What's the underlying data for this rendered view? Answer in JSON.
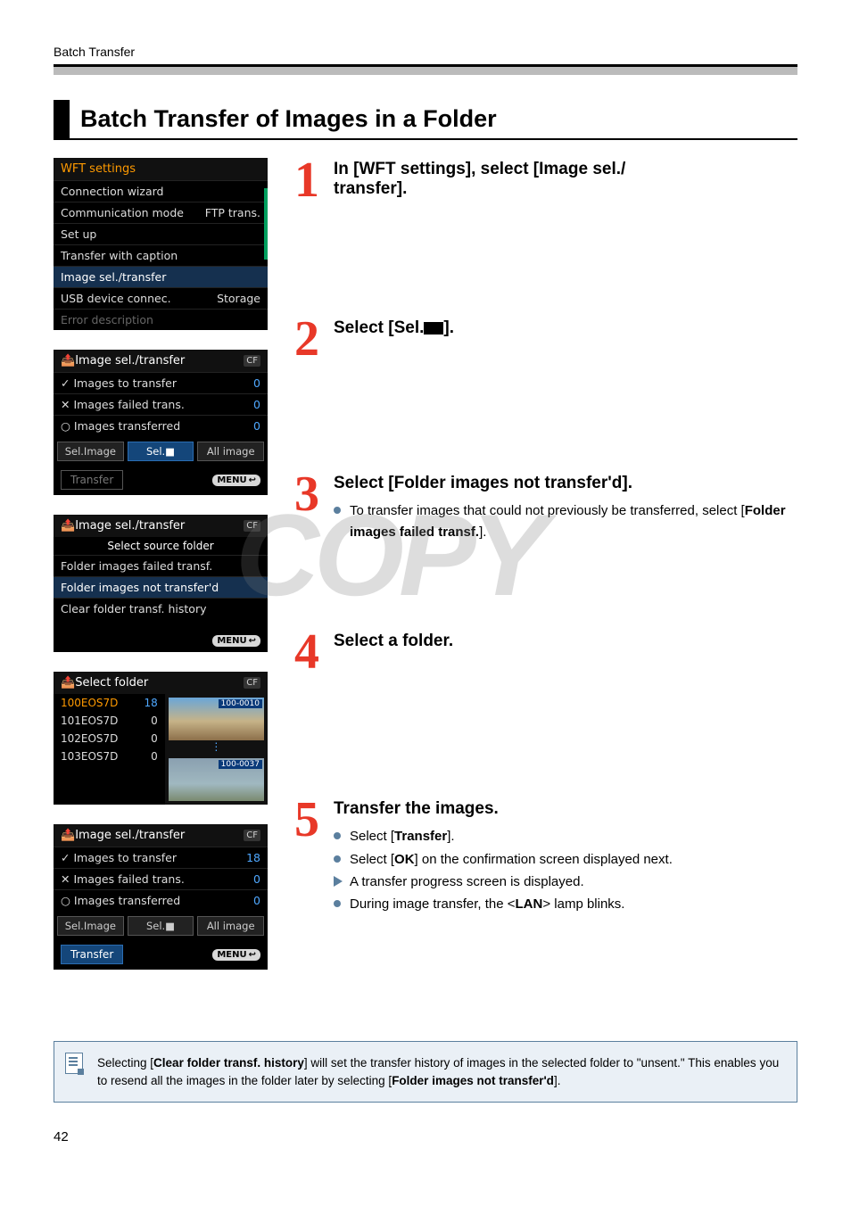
{
  "running_head": "Batch Transfer",
  "section_title": "Batch Transfer of Images in a Folder",
  "watermark": "COPY",
  "page_number": "42",
  "panel1": {
    "title": "WFT settings",
    "rows": [
      {
        "label": "Connection wizard",
        "value": ""
      },
      {
        "label": "Communication mode",
        "value": "FTP trans."
      },
      {
        "label": "Set up",
        "value": ""
      },
      {
        "label": "Transfer with caption",
        "value": ""
      },
      {
        "label": "Image sel./transfer",
        "value": "",
        "highlight": true
      },
      {
        "label": "USB device connec.",
        "value": "Storage"
      },
      {
        "label": "Error description",
        "value": "",
        "dim": true
      }
    ]
  },
  "panel2": {
    "title": "Image sel./transfer",
    "badge": "CF",
    "counts": [
      {
        "icon": "✓",
        "label": "Images to transfer",
        "value": "0"
      },
      {
        "icon": "✕",
        "label": "Images failed trans.",
        "value": "0"
      },
      {
        "icon": "○",
        "label": "Images transferred",
        "value": "0"
      }
    ],
    "buttons": [
      "Sel.Image",
      "Sel.■",
      "All image"
    ],
    "active_button": 1,
    "transfer_label": "Transfer",
    "transfer_active": false,
    "menu_label": "MENU"
  },
  "panel3": {
    "title": "Image sel./transfer",
    "badge": "CF",
    "subtitle": "Select source folder",
    "rows": [
      "Folder images failed transf.",
      "Folder images not transfer'd",
      "Clear folder transf. history"
    ],
    "highlight_index": 1,
    "menu_label": "MENU"
  },
  "panel4": {
    "title": "Select folder",
    "badge": "CF",
    "folders": [
      {
        "name": "100EOS7D",
        "count": "18",
        "selected": true
      },
      {
        "name": "101EOS7D",
        "count": "0"
      },
      {
        "name": "102EOS7D",
        "count": "0"
      },
      {
        "name": "103EOS7D",
        "count": "0"
      }
    ],
    "thumb1_label": "100-0010",
    "thumb2_label": "100-0037"
  },
  "panel5": {
    "title": "Image sel./transfer",
    "badge": "CF",
    "counts": [
      {
        "icon": "✓",
        "label": "Images to transfer",
        "value": "18"
      },
      {
        "icon": "✕",
        "label": "Images failed trans.",
        "value": "0"
      },
      {
        "icon": "○",
        "label": "Images transferred",
        "value": "0"
      }
    ],
    "buttons": [
      "Sel.Image",
      "Sel.■",
      "All image"
    ],
    "active_button": -1,
    "transfer_label": "Transfer",
    "transfer_active": true,
    "menu_label": "MENU"
  },
  "steps": {
    "s1": {
      "num": "1",
      "head_a": "In [WFT settings], select [Image sel./",
      "head_b": "transfer]."
    },
    "s2": {
      "num": "2",
      "head": "Select [Sel.",
      "head_tail": "]."
    },
    "s3": {
      "num": "3",
      "head": "Select [Folder images not transfer'd].",
      "b1a": "To transfer images that could not previously be transferred, select [",
      "b1b": "Folder images failed transf.",
      "b1c": "]."
    },
    "s4": {
      "num": "4",
      "head": "Select a folder."
    },
    "s5": {
      "num": "5",
      "head": "Transfer the images.",
      "b1a": "Select [",
      "b1b": "Transfer",
      "b1c": "].",
      "b2a": "Select [",
      "b2b": "OK",
      "b2c": "] on the confirmation screen displayed next.",
      "b3": "A transfer progress screen is displayed.",
      "b4a": "During image transfer, the <",
      "b4b": "LAN",
      "b4c": "> lamp blinks."
    }
  },
  "note": {
    "a": "Selecting [",
    "b": "Clear folder transf. history",
    "c": "] will set the transfer history of images in the selected folder to \"unsent.\" This enables you to resend all the images in the folder later by selecting [",
    "d": "Folder images not transfer'd",
    "e": "]."
  }
}
